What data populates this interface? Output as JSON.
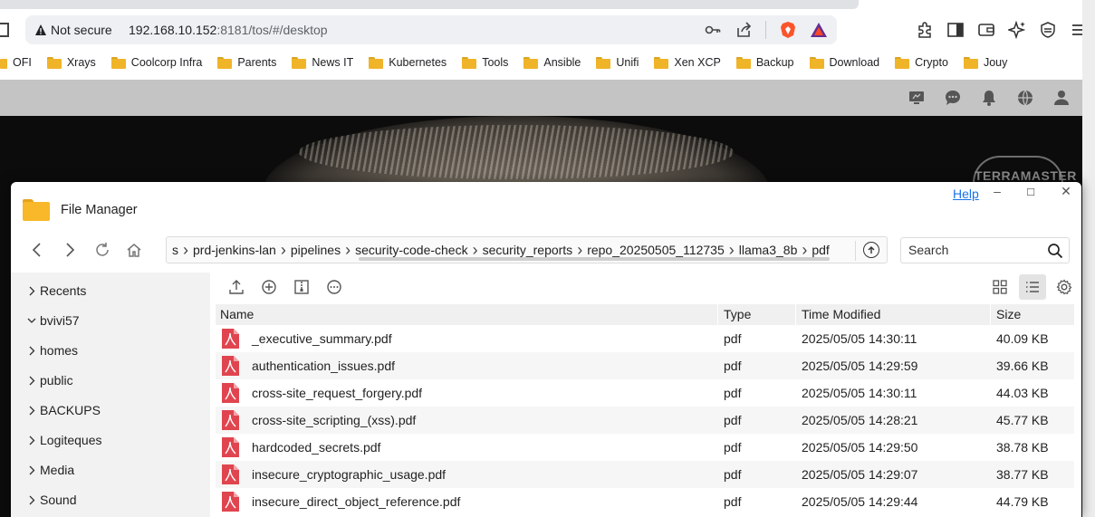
{
  "browser": {
    "security_label": "Not secure",
    "url_host": "192.168.10.152",
    "url_rest": ":8181/tos/#/desktop",
    "bookmarks": [
      {
        "label": "OFI"
      },
      {
        "label": "Xrays"
      },
      {
        "label": "Coolcorp Infra"
      },
      {
        "label": "Parents"
      },
      {
        "label": "News IT"
      },
      {
        "label": "Kubernetes"
      },
      {
        "label": "Tools"
      },
      {
        "label": "Ansible"
      },
      {
        "label": "Unifi"
      },
      {
        "label": "Xen XCP"
      },
      {
        "label": "Backup"
      },
      {
        "label": "Download"
      },
      {
        "label": "Crypto"
      },
      {
        "label": "Jouy"
      }
    ]
  },
  "desktop": {
    "brand": "TERRAMASTER"
  },
  "file_manager": {
    "title": "File Manager",
    "help": "Help",
    "breadcrumb": [
      "s",
      "prd-jenkins-lan",
      "pipelines",
      "security-code-check",
      "security_reports",
      "repo_20250505_112735",
      "llama3_8b",
      "pdf"
    ],
    "search_placeholder": "Search",
    "sidebar": [
      {
        "label": "Recents",
        "expanded": false
      },
      {
        "label": "bvivi57",
        "expanded": true
      },
      {
        "label": "homes",
        "expanded": false
      },
      {
        "label": "public",
        "expanded": false
      },
      {
        "label": "BACKUPS",
        "expanded": false
      },
      {
        "label": "Logiteques",
        "expanded": false
      },
      {
        "label": "Media",
        "expanded": false
      },
      {
        "label": "Sound",
        "expanded": false
      }
    ],
    "columns": {
      "name": "Name",
      "type": "Type",
      "modified": "Time Modified",
      "size": "Size"
    },
    "files": [
      {
        "name": "_executive_summary.pdf",
        "type": "pdf",
        "modified": "2025/05/05 14:30:11",
        "size": "40.09 KB"
      },
      {
        "name": "authentication_issues.pdf",
        "type": "pdf",
        "modified": "2025/05/05 14:29:59",
        "size": "39.66 KB"
      },
      {
        "name": "cross-site_request_forgery.pdf",
        "type": "pdf",
        "modified": "2025/05/05 14:30:11",
        "size": "44.03 KB"
      },
      {
        "name": "cross-site_scripting_(xss).pdf",
        "type": "pdf",
        "modified": "2025/05/05 14:28:21",
        "size": "45.77 KB"
      },
      {
        "name": "hardcoded_secrets.pdf",
        "type": "pdf",
        "modified": "2025/05/05 14:29:50",
        "size": "38.78 KB"
      },
      {
        "name": "insecure_cryptographic_usage.pdf",
        "type": "pdf",
        "modified": "2025/05/05 14:29:07",
        "size": "38.77 KB"
      },
      {
        "name": "insecure_direct_object_reference.pdf",
        "type": "pdf",
        "modified": "2025/05/05 14:29:44",
        "size": "44.79 KB"
      }
    ]
  },
  "colors": {
    "accent": "#1a73e8",
    "folder": "#f8b82a",
    "pdf_red": "#e0454f",
    "selected_view": "#e3e3e3"
  },
  "icons": [
    "warning-icon",
    "key-icon",
    "share-icon",
    "brave-icon",
    "rewards-icon",
    "extensions-icon",
    "sidebar-icon",
    "wallet-icon",
    "sparkle-icon",
    "vpn-icon",
    "menu-icon",
    "monitor-icon",
    "chat-icon",
    "bell-icon",
    "globe-icon",
    "user-icon"
  ]
}
